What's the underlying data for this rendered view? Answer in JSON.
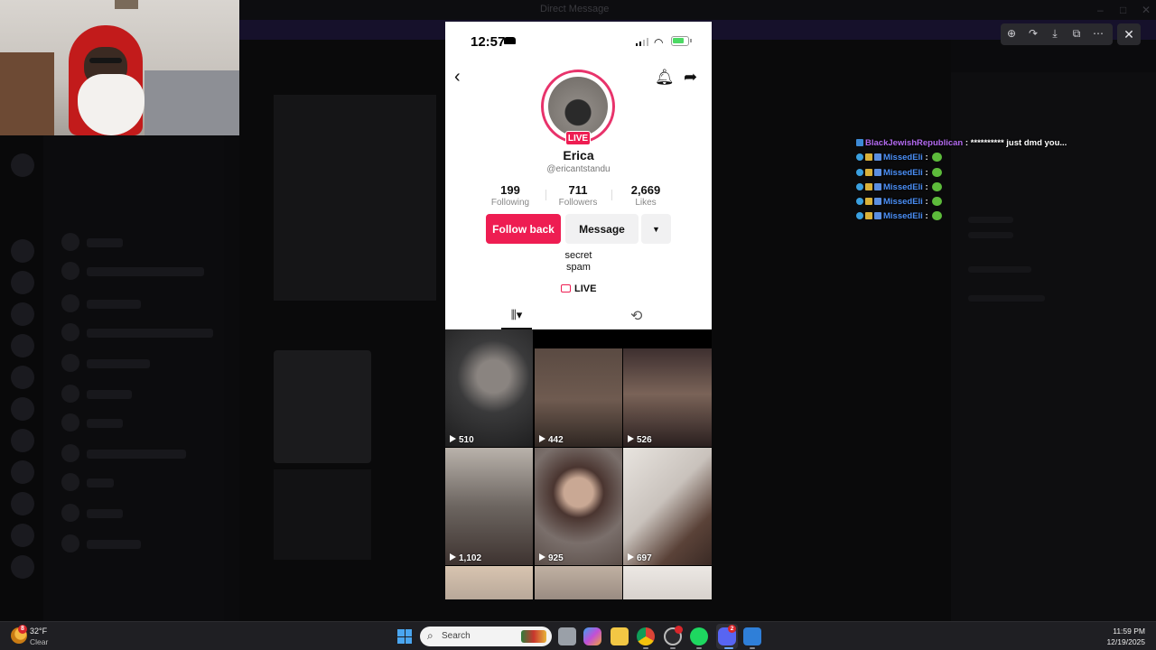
{
  "background_app": {
    "title": "Direct Message",
    "window_controls": [
      "–",
      "□",
      "✕"
    ]
  },
  "phone": {
    "status_time": "12:57",
    "header": {
      "back_icon": "chevron-left-icon",
      "bell_icon": "bell-icon",
      "share_icon": "share-arrow-icon"
    },
    "profile": {
      "live_badge": "LIVE",
      "name": "Erica",
      "handle": "@ericantstandu",
      "stats": [
        {
          "value": "199",
          "label": "Following"
        },
        {
          "value": "711",
          "label": "Followers"
        },
        {
          "value": "2,669",
          "label": "Likes"
        }
      ],
      "follow_label": "Follow back",
      "message_label": "Message",
      "more_label": "▼",
      "bio_line1": "secret",
      "bio_line2": "spam",
      "live_link": "LIVE"
    },
    "tabs": {
      "grid_icon": "grid-icon",
      "grid_label": "⫼▾",
      "repost_icon": "repost-icon",
      "repost_label": "⟲"
    },
    "videos": [
      {
        "views": "510",
        "color": "#3a3a3b"
      },
      {
        "views": "442",
        "color": "#5a4a42"
      },
      {
        "views": "526",
        "color": "#3d2f2f"
      },
      {
        "views": "1,102",
        "color": "#6c6560"
      },
      {
        "views": "925",
        "color": "#7a6f6b"
      },
      {
        "views": "697",
        "color": "#c9c2bc"
      },
      {
        "views": "",
        "color": "#b8a899"
      },
      {
        "views": "",
        "color": "#9a8c82"
      },
      {
        "views": "",
        "color": "#d8d2cd"
      }
    ]
  },
  "chat": {
    "messages": [
      {
        "user": "BlackJewishRepublican",
        "text": " : ********** just dmd you..."
      },
      {
        "user": "MissedEli",
        "text": " : "
      },
      {
        "user": "MissedEli",
        "text": " : "
      },
      {
        "user": "MissedEli",
        "text": " : "
      },
      {
        "user": "MissedEli",
        "text": " : "
      },
      {
        "user": "MissedEli",
        "text": " : "
      }
    ],
    "colors": {
      "purple": "#b36af0",
      "blue": "#4a8ef5"
    }
  },
  "viewer_toolbar": {
    "zoom_icon": "⊕",
    "rotate_icon": "↷",
    "download_icon": "⤓",
    "open_icon": "⧉",
    "more_icon": "⋯",
    "close_icon": "✕"
  },
  "taskbar": {
    "weather_badge": "8",
    "weather_temp": "32°F",
    "weather_cond": "Clear",
    "search_placeholder": "Search",
    "apps": [
      "file-explorer-icon",
      "copilot-icon",
      "folder-icon",
      "chrome-icon",
      "obs-icon",
      "spotify-icon",
      "discord-icon",
      "photos-icon"
    ],
    "discord_badge": "2",
    "time": "11:59 PM",
    "date": "12/19/2025"
  }
}
